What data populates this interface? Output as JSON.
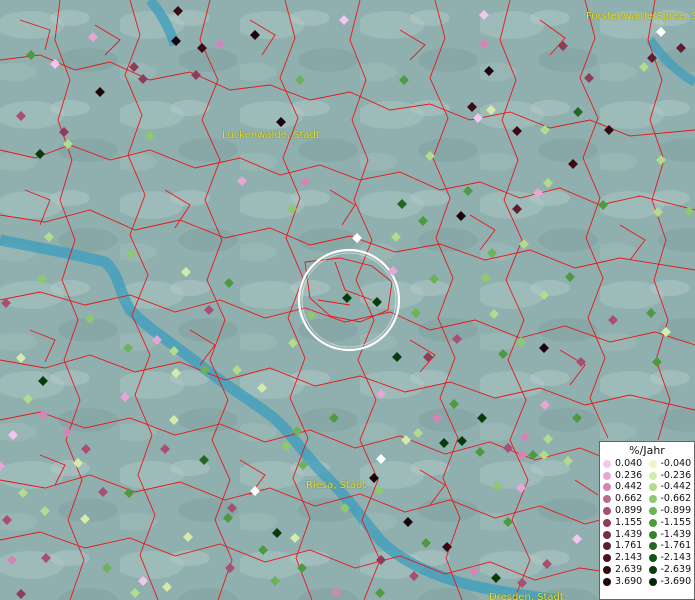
{
  "map": {
    "cities": [
      {
        "name": "Fürstenwalde/Spree, St",
        "id": "fuerstenwalde"
      },
      {
        "name": "Luckenwalde, Stadt",
        "id": "luckenwalde"
      },
      {
        "name": "Riesa, Stadt",
        "id": "riesa"
      },
      {
        "name": "Dresden, Stadt",
        "id": "dresden"
      }
    ]
  },
  "legend": {
    "title": "%/Jahr",
    "positive": [
      {
        "label": "0.040",
        "color": "#f4c6ef"
      },
      {
        "label": "0.236",
        "color": "#e6a6d6"
      },
      {
        "label": "0.442",
        "color": "#d684b8"
      },
      {
        "label": "0.662",
        "color": "#c06894"
      },
      {
        "label": "0.899",
        "color": "#a84f74"
      },
      {
        "label": "1.155",
        "color": "#8e3c5a"
      },
      {
        "label": "1.439",
        "color": "#762c45"
      },
      {
        "label": "1.761",
        "color": "#5e1e32"
      },
      {
        "label": "2.143",
        "color": "#481322"
      },
      {
        "label": "2.639",
        "color": "#320a15"
      },
      {
        "label": "3.690",
        "color": "#1c040a"
      }
    ],
    "negative": [
      {
        "label": "-0.040",
        "color": "#eef6c4"
      },
      {
        "label": "-0.236",
        "color": "#d4ecaa"
      },
      {
        "label": "-0.442",
        "color": "#b2dc8c"
      },
      {
        "label": "-0.662",
        "color": "#8ec870"
      },
      {
        "label": "-0.899",
        "color": "#6cb256"
      },
      {
        "label": "-1.155",
        "color": "#4e9a40"
      },
      {
        "label": "-1.439",
        "color": "#36802e"
      },
      {
        "label": "-1.761",
        "color": "#236820"
      },
      {
        "label": "-2.143",
        "color": "#135214"
      },
      {
        "label": "-2.639",
        "color": "#083c0a"
      },
      {
        "label": "-3.690",
        "color": "#022604"
      }
    ]
  }
}
